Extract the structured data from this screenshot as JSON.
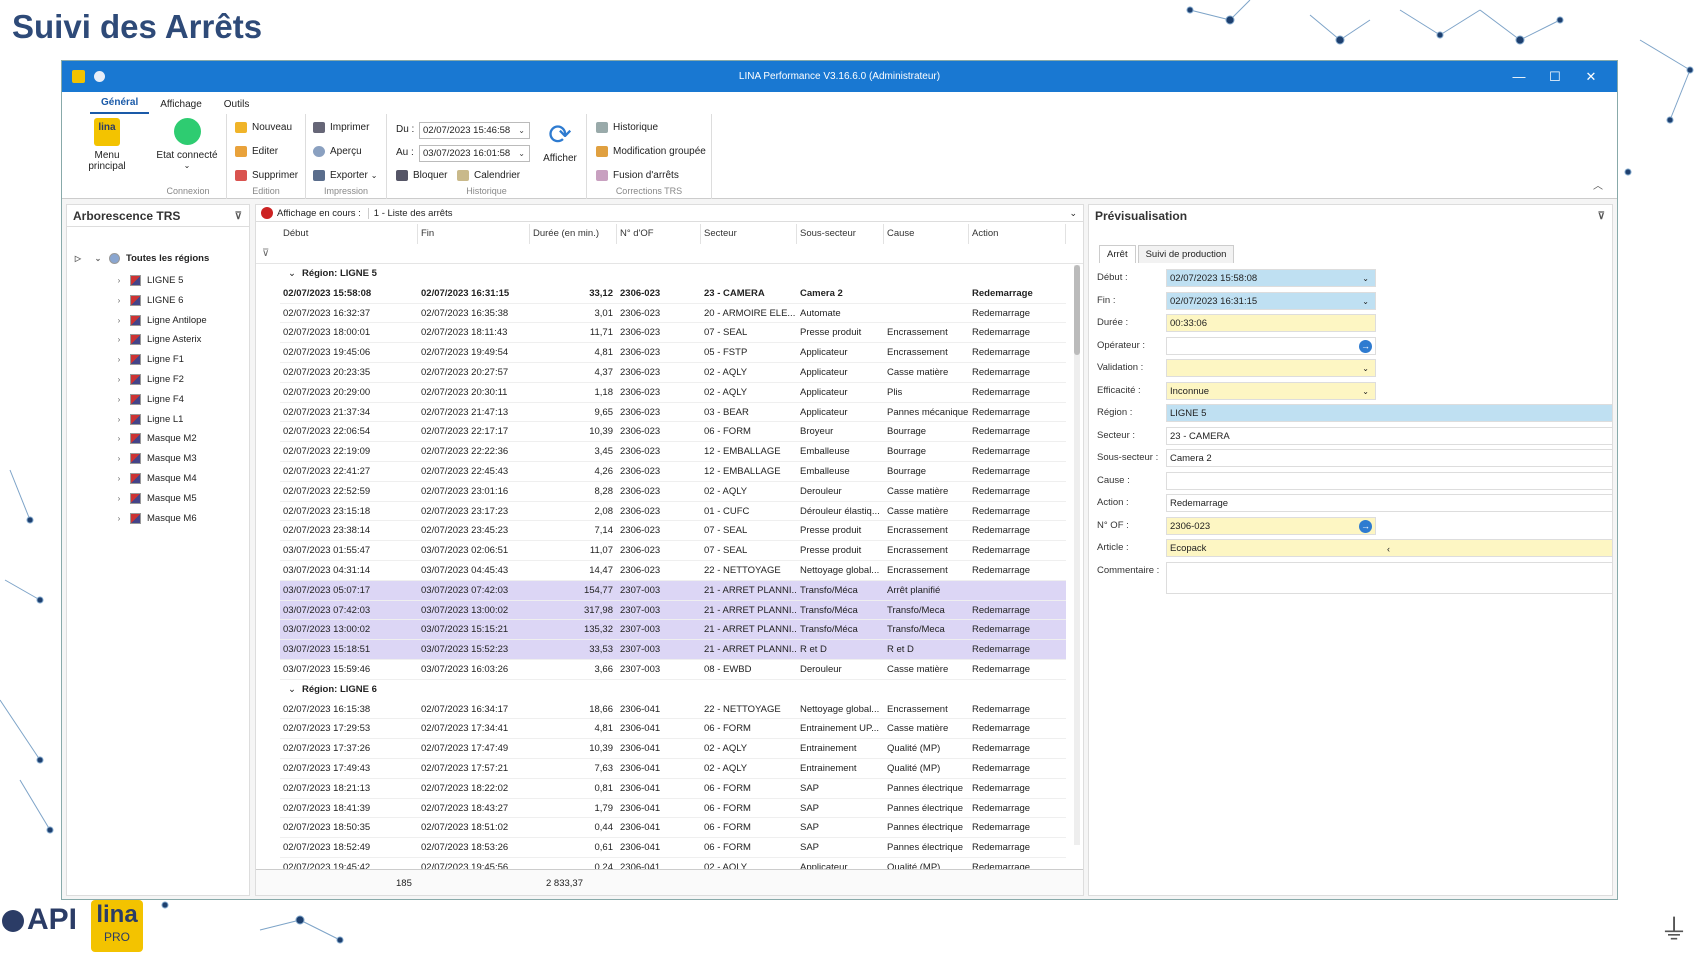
{
  "slide_title": "Suivi des Arrêts",
  "window": {
    "title": "LINA Performance  V3.16.6.0  (Administrateur)",
    "controls": [
      "—",
      "☐",
      "✕"
    ]
  },
  "menu_tabs": [
    "Général",
    "Affichage",
    "Outils"
  ],
  "ribbon": {
    "menu_principal": "Menu principal",
    "etat_connecte": "Etat connecté",
    "nouveau": "Nouveau",
    "editer": "Editer",
    "supprimer": "Supprimer",
    "imprimer": "Imprimer",
    "apercu": "Aperçu",
    "exporter": "Exporter",
    "du_label": "Du :",
    "du_value": "02/07/2023 15:46:58",
    "au_label": "Au :",
    "au_value": "03/07/2023 16:01:58",
    "bloquer": "Bloquer",
    "calendrier": "Calendrier",
    "afficher": "Afficher",
    "historique": "Historique",
    "modification_groupee": "Modification groupée",
    "fusion_arrets": "Fusion d'arrêts",
    "group_connexion": "Connexion",
    "group_edition": "Edition",
    "group_impression": "Impression",
    "group_historique": "Historique",
    "group_corrections": "Corrections TRS",
    "logo_text": "lina",
    "colors": {
      "connected": "#2ecc71",
      "titlebar": "#1978d2"
    }
  },
  "left_pane": {
    "title": "Arborescence TRS",
    "root": "Toutes les régions",
    "items": [
      "LIGNE 5",
      "LIGNE 6",
      "Ligne Antilope",
      "Ligne Asterix",
      "Ligne F1",
      "Ligne F2",
      "Ligne F4",
      "Ligne L1",
      "Masque M2",
      "Masque M3",
      "Masque M4",
      "Masque M5",
      "Masque M6"
    ]
  },
  "grid": {
    "affichage_label": "Affichage en cours :",
    "affichage_value": "1 - Liste des arrêts",
    "columns": [
      "Début",
      "Fin",
      "Durée (en min.)",
      "N° d'OF",
      "Secteur",
      "Sous-secteur",
      "Cause",
      "Action"
    ],
    "region1": "Région: LIGNE 5",
    "region2": "Région: LIGNE 6",
    "rows1": [
      [
        "02/07/2023 15:58:08",
        "02/07/2023 16:31:15",
        "33,12",
        "2306-023",
        "23 - CAMERA",
        "Camera 2",
        "",
        "Redemarrage"
      ],
      [
        "02/07/2023 16:32:37",
        "02/07/2023 16:35:38",
        "3,01",
        "2306-023",
        "20 - ARMOIRE ELE...",
        "Automate",
        "",
        "Redemarrage"
      ],
      [
        "02/07/2023 18:00:01",
        "02/07/2023 18:11:43",
        "11,71",
        "2306-023",
        "07 - SEAL",
        "Presse produit",
        "Encrassement",
        "Redemarrage"
      ],
      [
        "02/07/2023 19:45:06",
        "02/07/2023 19:49:54",
        "4,81",
        "2306-023",
        "05 - FSTP",
        "Applicateur",
        "Encrassement",
        "Redemarrage"
      ],
      [
        "02/07/2023 20:23:35",
        "02/07/2023 20:27:57",
        "4,37",
        "2306-023",
        "02 - AQLY",
        "Applicateur",
        "Casse matière",
        "Redemarrage"
      ],
      [
        "02/07/2023 20:29:00",
        "02/07/2023 20:30:11",
        "1,18",
        "2306-023",
        "02 - AQLY",
        "Applicateur",
        "Plis",
        "Redemarrage"
      ],
      [
        "02/07/2023 21:37:34",
        "02/07/2023 21:47:13",
        "9,65",
        "2306-023",
        "03 - BEAR",
        "Applicateur",
        "Pannes mécanique",
        "Redemarrage"
      ],
      [
        "02/07/2023 22:06:54",
        "02/07/2023 22:17:17",
        "10,39",
        "2306-023",
        "06 - FORM",
        "Broyeur",
        "Bourrage",
        "Redemarrage"
      ],
      [
        "02/07/2023 22:19:09",
        "02/07/2023 22:22:36",
        "3,45",
        "2306-023",
        "12 - EMBALLAGE",
        "Emballeuse",
        "Bourrage",
        "Redemarrage"
      ],
      [
        "02/07/2023 22:41:27",
        "02/07/2023 22:45:43",
        "4,26",
        "2306-023",
        "12 - EMBALLAGE",
        "Emballeuse",
        "Bourrage",
        "Redemarrage"
      ],
      [
        "02/07/2023 22:52:59",
        "02/07/2023 23:01:16",
        "8,28",
        "2306-023",
        "02 - AQLY",
        "Derouleur",
        "Casse matière",
        "Redemarrage"
      ],
      [
        "02/07/2023 23:15:18",
        "02/07/2023 23:17:23",
        "2,08",
        "2306-023",
        "01 - CUFC",
        "Dérouleur élastiq...",
        "Casse matière",
        "Redemarrage"
      ],
      [
        "02/07/2023 23:38:14",
        "02/07/2023 23:45:23",
        "7,14",
        "2306-023",
        "07 - SEAL",
        "Presse produit",
        "Encrassement",
        "Redemarrage"
      ],
      [
        "03/07/2023 01:55:47",
        "03/07/2023 02:06:51",
        "11,07",
        "2306-023",
        "07 - SEAL",
        "Presse produit",
        "Encrassement",
        "Redemarrage"
      ],
      [
        "03/07/2023 04:31:14",
        "03/07/2023 04:45:43",
        "14,47",
        "2306-023",
        "22 - NETTOYAGE",
        "Nettoyage global...",
        "Encrassement",
        "Redemarrage"
      ],
      [
        "03/07/2023 05:07:17",
        "03/07/2023 07:42:03",
        "154,77",
        "2307-003",
        "21 - ARRET PLANNI...",
        "Transfo/Méca",
        "Arrêt planifié",
        ""
      ],
      [
        "03/07/2023 07:42:03",
        "03/07/2023 13:00:02",
        "317,98",
        "2307-003",
        "21 - ARRET PLANNI...",
        "Transfo/Méca",
        "Transfo/Meca",
        "Redemarrage"
      ],
      [
        "03/07/2023 13:00:02",
        "03/07/2023 15:15:21",
        "135,32",
        "2307-003",
        "21 - ARRET PLANNI...",
        "Transfo/Méca",
        "Transfo/Meca",
        "Redemarrage"
      ],
      [
        "03/07/2023 15:18:51",
        "03/07/2023 15:52:23",
        "33,53",
        "2307-003",
        "21 - ARRET PLANNI...",
        "R et D",
        "R et D",
        "Redemarrage"
      ],
      [
        "03/07/2023 15:59:46",
        "03/07/2023 16:03:26",
        "3,66",
        "2307-003",
        "08 - EWBD",
        "Derouleur",
        "Casse matière",
        "Redemarrage"
      ]
    ],
    "rows2": [
      [
        "02/07/2023 16:15:38",
        "02/07/2023 16:34:17",
        "18,66",
        "2306-041",
        "22 - NETTOYAGE",
        "Nettoyage global...",
        "Encrassement",
        "Redemarrage"
      ],
      [
        "02/07/2023 17:29:53",
        "02/07/2023 17:34:41",
        "4,81",
        "2306-041",
        "06 - FORM",
        "Entrainement UP...",
        "Casse matière",
        "Redemarrage"
      ],
      [
        "02/07/2023 17:37:26",
        "02/07/2023 17:47:49",
        "10,39",
        "2306-041",
        "02 - AQLY",
        "Entrainement",
        "Qualité (MP)",
        "Redemarrage"
      ],
      [
        "02/07/2023 17:49:43",
        "02/07/2023 17:57:21",
        "7,63",
        "2306-041",
        "02 - AQLY",
        "Entrainement",
        "Qualité (MP)",
        "Redemarrage"
      ],
      [
        "02/07/2023 18:21:13",
        "02/07/2023 18:22:02",
        "0,81",
        "2306-041",
        "06 - FORM",
        "SAP",
        "Pannes électrique",
        "Redemarrage"
      ],
      [
        "02/07/2023 18:41:39",
        "02/07/2023 18:43:27",
        "1,79",
        "2306-041",
        "06 - FORM",
        "SAP",
        "Pannes électrique",
        "Redemarrage"
      ],
      [
        "02/07/2023 18:50:35",
        "02/07/2023 18:51:02",
        "0,44",
        "2306-041",
        "06 - FORM",
        "SAP",
        "Pannes électrique",
        "Redemarrage"
      ],
      [
        "02/07/2023 18:52:49",
        "02/07/2023 18:53:26",
        "0,61",
        "2306-041",
        "06 - FORM",
        "SAP",
        "Pannes électrique",
        "Redemarrage"
      ],
      [
        "02/07/2023 19:45:42",
        "02/07/2023 19:45:56",
        "0,24",
        "2306-041",
        "02 - AQLY",
        "Applicateur",
        "Qualité (MP)",
        "Redemarrage"
      ]
    ],
    "footer_count": "185",
    "footer_total": "2 833,37"
  },
  "preview": {
    "title": "Prévisualisation",
    "tabs": [
      "Arrêt",
      "Suivi de production"
    ],
    "fields": {
      "debut_label": "Début :",
      "debut_value": "02/07/2023 15:58:08",
      "fin_label": "Fin :",
      "fin_value": "02/07/2023 16:31:15",
      "duree_label": "Durée :",
      "duree_value": "00:33:06",
      "operateur_label": "Opérateur :",
      "operateur_value": "",
      "validation_label": "Validation :",
      "validation_value": "",
      "efficacite_label": "Efficacité :",
      "efficacite_value": "Inconnue",
      "region_label": "Région :",
      "region_value": "LIGNE 5",
      "secteur_label": "Secteur :",
      "secteur_value": "23 - CAMERA",
      "soussecteur_label": "Sous-secteur :",
      "soussecteur_value": "Camera 2",
      "cause_label": "Cause :",
      "cause_value": "",
      "action_label": "Action :",
      "action_value": "Redemarrage",
      "nof_label": "N° OF :",
      "nof_value": "2306-023",
      "article_label": "Article :",
      "article_value": "Ecopack",
      "commentaire_label": "Commentaire :"
    }
  },
  "logos": {
    "api": "API",
    "lina": "lina",
    "pro": "PRO"
  }
}
